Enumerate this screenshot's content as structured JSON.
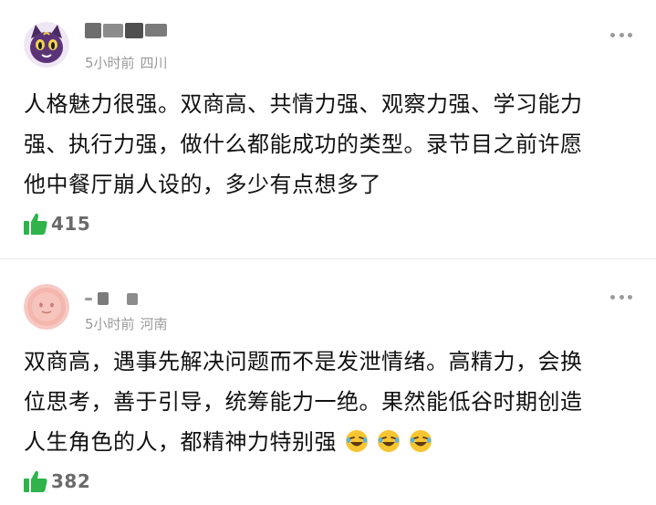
{
  "comments": [
    {
      "username_blurred": true,
      "time": "5小时前",
      "location": "四川",
      "text_lines": [
        "人格魅力很强。双商高、共情力强、观察力强、学习能力",
        "强、执行力强，做什么都能成功的类型。录节目之前许愿",
        "他中餐厅崩人设的，多少有点想多了"
      ],
      "likes": "415",
      "avatar_icon": "purple-cat-icon"
    },
    {
      "username_blurred": true,
      "time": "5小时前",
      "location": "河南",
      "text_lines": [
        "双商高，遇事先解决问题而不是发泄情绪。高精力，会换",
        "位思考，善于引导，统筹能力一绝。果然能低谷时期创造",
        "人生角色的人，都精神力特别强"
      ],
      "emoji_count": 3,
      "emoji_icon": "rolling-laugh-emoji-icon",
      "likes": "382",
      "avatar_icon": "pink-face-icon"
    }
  ],
  "colors": {
    "like_green": "#2fb34a",
    "meta_gray": "#9a9a9a",
    "text": "#111111"
  }
}
